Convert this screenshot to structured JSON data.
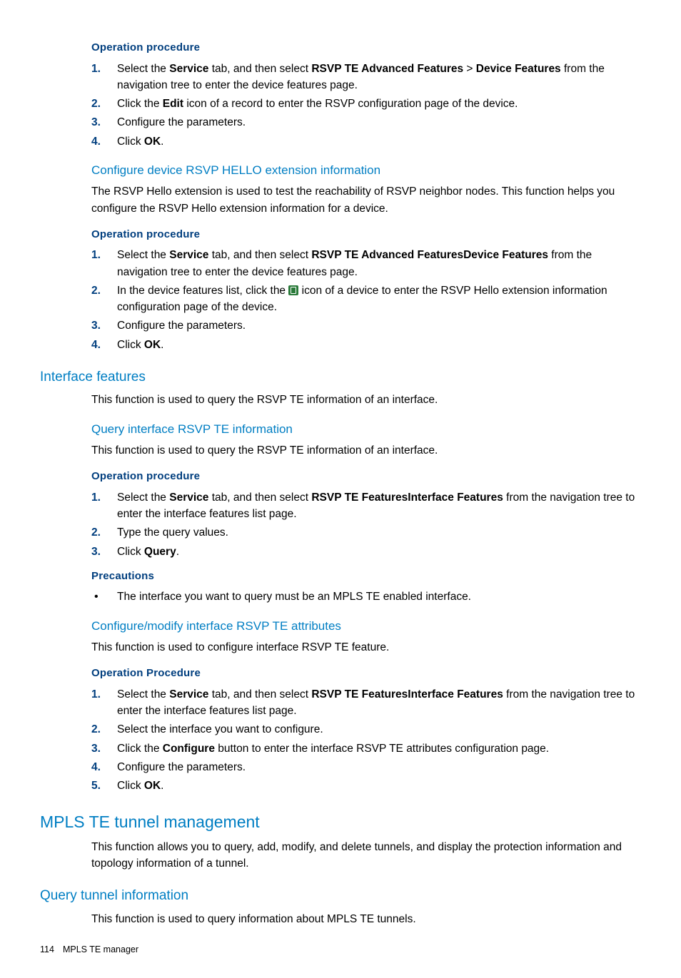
{
  "section1": {
    "opHeader": "Operation procedure",
    "steps": [
      {
        "pre": "Select the ",
        "b1": "Service",
        "mid1": " tab, and then select ",
        "b2": "RSVP TE Advanced Features",
        "gt": " > ",
        "b3": "Device Features",
        "post": " from the navigation tree to enter the device features page."
      },
      {
        "pre": "Click the ",
        "b1": "Edit",
        "post": " icon of a record to enter the RSVP configuration page of the device."
      },
      {
        "text": "Configure the parameters."
      },
      {
        "pre": "Click ",
        "b1": "OK",
        "post": "."
      }
    ]
  },
  "section2": {
    "subHeader": "Configure device RSVP HELLO extension information",
    "intro": "The RSVP Hello extension is used to test the reachability of RSVP neighbor nodes. This function helps you configure the RSVP Hello extension information for a device.",
    "opHeader": "Operation procedure",
    "steps": [
      {
        "pre": "Select the ",
        "b1": "Service",
        "mid1": " tab, and then select ",
        "b2": "RSVP TE Advanced FeaturesDevice Features",
        "post": " from the navigation tree to enter the device features page."
      },
      {
        "pre": "In the device features list, click the ",
        "icon": true,
        "post": " icon of a device to enter the RSVP Hello extension information configuration page of the device."
      },
      {
        "text": "Configure the parameters."
      },
      {
        "pre": "Click ",
        "b1": "OK",
        "post": "."
      }
    ]
  },
  "section3": {
    "sectionHeader": "Interface features",
    "intro": "This function is used to query the RSVP TE information of an interface.",
    "sub1": {
      "subHeader": "Query interface RSVP TE information",
      "intro": "This function is used to query the RSVP TE information of an interface.",
      "opHeader": "Operation procedure",
      "steps": [
        {
          "pre": "Select the ",
          "b1": "Service",
          "mid1": " tab, and then select ",
          "b2": "RSVP TE FeaturesInterface Features",
          "post": " from the navigation tree to enter the interface features list page."
        },
        {
          "text": "Type the query values."
        },
        {
          "pre": "Click ",
          "b1": "Query",
          "post": "."
        }
      ],
      "precHeader": "Precautions",
      "precItems": [
        "The interface you want to query must be an MPLS TE enabled interface."
      ]
    },
    "sub2": {
      "subHeader": "Configure/modify interface RSVP TE attributes",
      "intro": "This function is used to configure interface RSVP TE feature.",
      "opHeader": "Operation Procedure",
      "steps": [
        {
          "pre": "Select the ",
          "b1": "Service",
          "mid1": " tab, and then select ",
          "b2": "RSVP TE FeaturesInterface Features",
          "post": " from the navigation tree to enter the interface features list page."
        },
        {
          "text": "Select the interface you want to configure."
        },
        {
          "pre": "Click the ",
          "b1": "Configure",
          "post": " button to enter the interface RSVP TE attributes configuration page."
        },
        {
          "text": "Configure the parameters."
        },
        {
          "pre": "Click ",
          "b1": "OK",
          "post": "."
        }
      ]
    }
  },
  "section4": {
    "h2": "MPLS TE tunnel management",
    "intro": "This function allows you to query, add, modify, and delete tunnels, and display the protection information and topology information of a tunnel.",
    "sub": {
      "sectionHeader": "Query tunnel information",
      "intro": "This function is used to query information about MPLS TE tunnels."
    }
  },
  "footer": {
    "pageNum": "114",
    "title": "MPLS TE manager"
  }
}
